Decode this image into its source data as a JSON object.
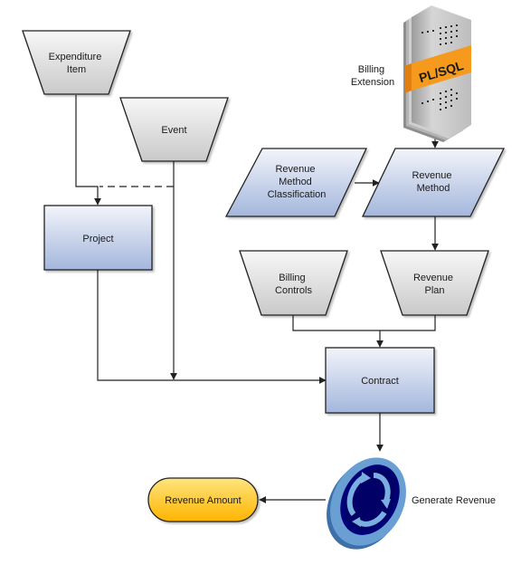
{
  "diagram": {
    "type": "flowchart",
    "nodes": {
      "expenditure_item": {
        "label_lines": [
          "Expenditure",
          "Item"
        ],
        "shape": "manual-operation"
      },
      "event": {
        "label_lines": [
          "Event"
        ],
        "shape": "manual-operation"
      },
      "project": {
        "label_lines": [
          "Project"
        ],
        "shape": "process"
      },
      "billing_extension": {
        "label_lines": [
          "Billing",
          "Extension"
        ],
        "icon_text": "PL/SQL",
        "shape": "plsql-package-icon"
      },
      "revenue_method_classification": {
        "label_lines": [
          "Revenue",
          "Method",
          "Classification"
        ],
        "shape": "data"
      },
      "revenue_method": {
        "label_lines": [
          "Revenue",
          "Method"
        ],
        "shape": "data"
      },
      "billing_controls": {
        "label_lines": [
          "Billing",
          "Controls"
        ],
        "shape": "manual-operation"
      },
      "revenue_plan": {
        "label_lines": [
          "Revenue",
          "Plan"
        ],
        "shape": "manual-operation"
      },
      "contract": {
        "label_lines": [
          "Contract"
        ],
        "shape": "process"
      },
      "generate_revenue": {
        "label_lines": [
          "Generate Revenue"
        ],
        "shape": "process-cycle-icon"
      },
      "revenue_amount": {
        "label_lines": [
          "Revenue Amount"
        ],
        "shape": "terminator"
      }
    },
    "edges": [
      {
        "from": "expenditure_item",
        "to": "project",
        "style": "solid"
      },
      {
        "from": "event",
        "to": "project",
        "style": "dashed"
      },
      {
        "from": "event",
        "to": "contract",
        "style": "solid"
      },
      {
        "from": "project",
        "to": "contract",
        "style": "solid"
      },
      {
        "from": "billing_extension",
        "to": "revenue_method",
        "style": "solid"
      },
      {
        "from": "revenue_method_classification",
        "to": "revenue_method",
        "style": "solid"
      },
      {
        "from": "revenue_method",
        "to": "revenue_plan",
        "style": "solid"
      },
      {
        "from": "billing_controls",
        "to": "contract",
        "style": "solid"
      },
      {
        "from": "revenue_plan",
        "to": "contract",
        "style": "solid"
      },
      {
        "from": "contract",
        "to": "generate_revenue",
        "style": "solid"
      },
      {
        "from": "generate_revenue",
        "to": "revenue_amount",
        "style": "solid"
      }
    ],
    "colors": {
      "gray_top": "#f7f7f7",
      "gray_bottom": "#c9c9c9",
      "blue_top": "#f2f4fa",
      "blue_bottom": "#a3b6dc",
      "yellow_top": "#ffe07a",
      "yellow_bottom": "#ffb400",
      "plsql_band": "#f59a1c",
      "cycle_ring": "#6a9fd4",
      "cycle_center": "#000070",
      "line": "#222222"
    }
  }
}
